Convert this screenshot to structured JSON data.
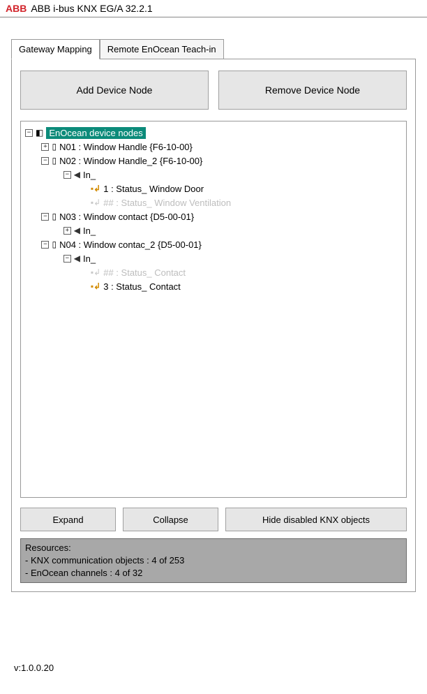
{
  "header": {
    "logo": "ABB",
    "title": "ABB i-bus KNX EG/A 32.2.1"
  },
  "tabs": {
    "gateway": "Gateway Mapping",
    "teachin": "Remote EnOcean Teach-in"
  },
  "buttons": {
    "add": "Add Device Node",
    "remove": "Remove Device Node",
    "expand": "Expand",
    "collapse": "Collapse",
    "hide": "Hide disabled KNX objects"
  },
  "tree": {
    "root": "EnOcean device nodes",
    "n01": "N01 : Window Handle {F6-10-00}",
    "n02": "N02 : Window Handle_2 {F6-10-00}",
    "n02_in": "In_",
    "n02_o1": "1 : Status_ Window Door",
    "n02_o2": "## : Status_ Window Ventilation",
    "n03": "N03 : Window contact {D5-00-01}",
    "n03_in": "In_",
    "n04": "N04 : Window contac_2 {D5-00-01}",
    "n04_in": "In_",
    "n04_o1": "## : Status_ Contact",
    "n04_o2": "3 : Status_ Contact"
  },
  "resources": {
    "title": "Resources:",
    "line1": "- KNX communication objects :  4 of 253",
    "line2": "- EnOcean channels :   4 of 32"
  },
  "version": "v:1.0.0.20"
}
